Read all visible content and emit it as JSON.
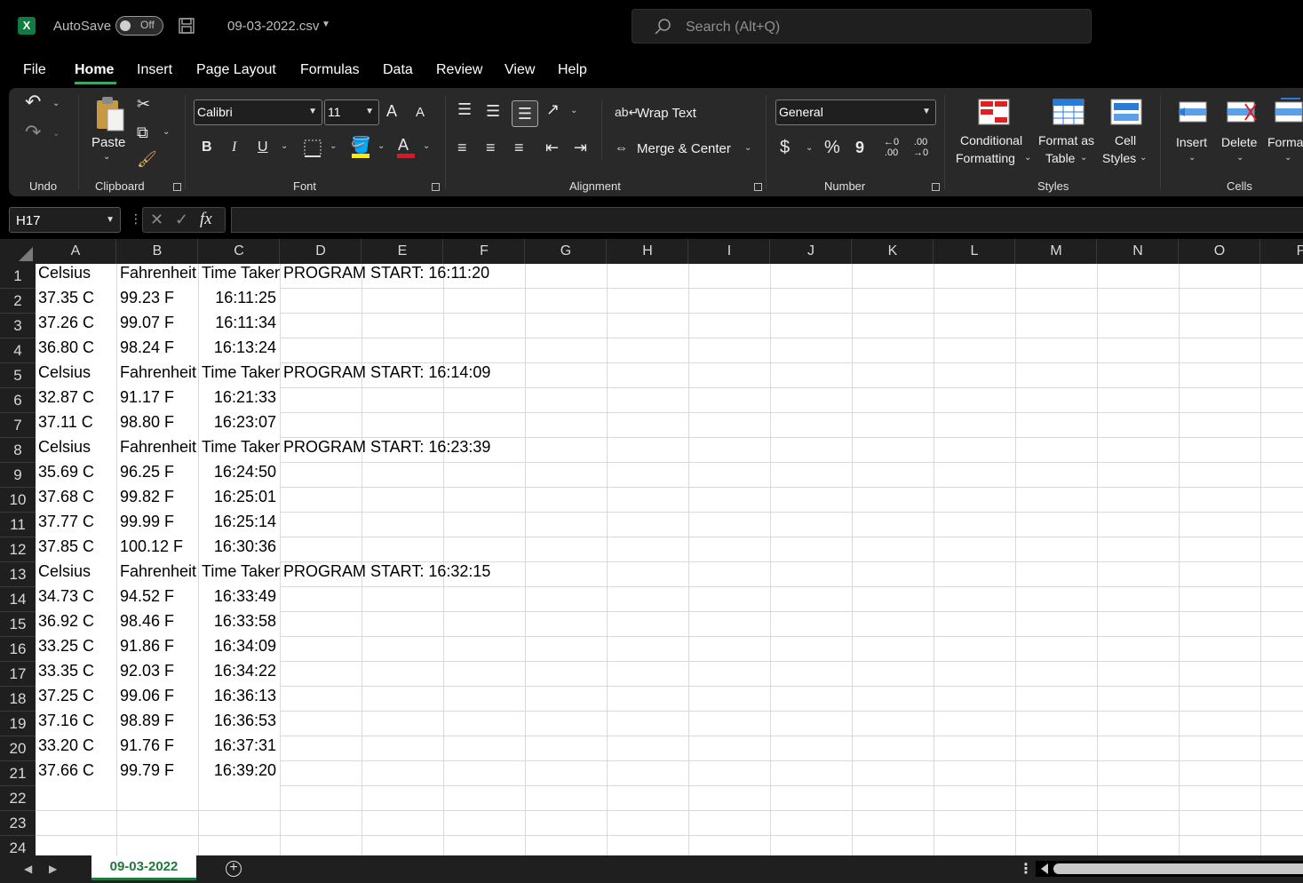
{
  "titlebar": {
    "app_logo": "X",
    "autosave_label": "AutoSave",
    "autosave_state": "Off",
    "filename": "09-03-2022.csv",
    "search_placeholder": "Search (Alt+Q)"
  },
  "menu": [
    "File",
    "Home",
    "Insert",
    "Page Layout",
    "Formulas",
    "Data",
    "Review",
    "View",
    "Help"
  ],
  "menu_active": "Home",
  "ribbon": {
    "undo_group": "Undo",
    "clipboard_group": "Clipboard",
    "paste_label": "Paste",
    "font_group": "Font",
    "font_name": "Calibri",
    "font_size": "11",
    "grow_font": "A",
    "shrink_font": "A",
    "bold": "B",
    "italic": "I",
    "underline": "U",
    "font_color_letter": "A",
    "alignment_group": "Alignment",
    "wrap_text": "Wrap Text",
    "merge_center": "Merge & Center",
    "number_group": "Number",
    "number_format": "General",
    "currency": "$",
    "percent": "%",
    "comma": "9",
    "styles_group": "Styles",
    "conditional_formatting_1": "Conditional",
    "conditional_formatting_2": "Formatting",
    "format_as_table_1": "Format as",
    "format_as_table_2": "Table",
    "cell_styles_1": "Cell",
    "cell_styles_2": "Styles",
    "cells_group": "Cells",
    "insert": "Insert",
    "delete": "Delete",
    "format": "Format",
    "colors": {
      "font_highlight": "#ffeb00",
      "font_color": "#e81123"
    }
  },
  "formula_bar": {
    "name_box": "H17",
    "fx_label": "fx",
    "formula": ""
  },
  "columns": [
    "A",
    "B",
    "C",
    "D",
    "E",
    "F",
    "G",
    "H",
    "I",
    "J",
    "K",
    "L",
    "M",
    "N",
    "O",
    "P"
  ],
  "rows": [
    "1",
    "2",
    "3",
    "4",
    "5",
    "6",
    "7",
    "8",
    "9",
    "10",
    "11",
    "12",
    "13",
    "14",
    "15",
    "16",
    "17",
    "18",
    "19",
    "20",
    "21",
    "22",
    "23",
    "24"
  ],
  "cells": [
    [
      "Celsius",
      "Fahrenheit",
      "Time Taken",
      "PROGRAM START: 16:11:20"
    ],
    [
      "37.35 C",
      "99.23 F",
      "16:11:25",
      ""
    ],
    [
      "37.26 C",
      "99.07 F",
      "16:11:34",
      ""
    ],
    [
      "36.80 C",
      "98.24 F",
      "16:13:24",
      ""
    ],
    [
      "Celsius",
      "Fahrenheit",
      "Time Taken",
      "PROGRAM START: 16:14:09"
    ],
    [
      "32.87 C",
      "91.17 F",
      "16:21:33",
      ""
    ],
    [
      "37.11 C",
      "98.80 F",
      "16:23:07",
      ""
    ],
    [
      "Celsius",
      "Fahrenheit",
      "Time Taken",
      "PROGRAM START: 16:23:39"
    ],
    [
      "35.69 C",
      "96.25 F",
      "16:24:50",
      ""
    ],
    [
      "37.68 C",
      "99.82 F",
      "16:25:01",
      ""
    ],
    [
      "37.77 C",
      "99.99 F",
      "16:25:14",
      ""
    ],
    [
      "37.85 C",
      "100.12 F",
      "16:30:36",
      ""
    ],
    [
      "Celsius",
      "Fahrenheit",
      "Time Taken",
      "PROGRAM START: 16:32:15"
    ],
    [
      "34.73 C",
      "94.52 F",
      "16:33:49",
      ""
    ],
    [
      "36.92 C",
      "98.46 F",
      "16:33:58",
      ""
    ],
    [
      "33.25 C",
      "91.86 F",
      "16:34:09",
      ""
    ],
    [
      "33.35 C",
      "92.03 F",
      "16:34:22",
      ""
    ],
    [
      "37.25 C",
      "99.06 F",
      "16:36:13",
      ""
    ],
    [
      "37.16 C",
      "98.89 F",
      "16:36:53",
      ""
    ],
    [
      "33.20 C",
      "91.76 F",
      "16:37:31",
      ""
    ],
    [
      "37.66 C",
      "99.79 F",
      "16:39:20",
      ""
    ]
  ],
  "sheet_tab": "09-03-2022"
}
